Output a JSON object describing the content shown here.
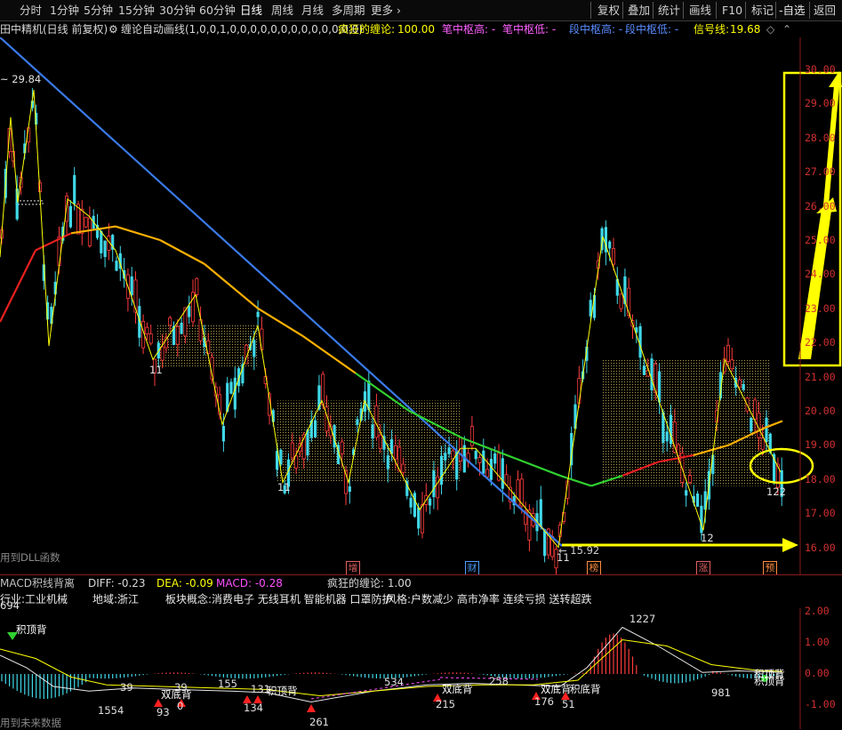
{
  "toolbar": {
    "periods": [
      "分时",
      "1分钟",
      "5分钟",
      "15分钟",
      "30分钟",
      "60分钟",
      "日线",
      "周线",
      "月线",
      "多周期",
      "更多"
    ],
    "active_period": "日线",
    "right_buttons": [
      "复权",
      "叠加",
      "统计",
      "画线",
      "F10",
      "标记",
      "自选",
      "返回"
    ]
  },
  "main_info": {
    "stock_name": "田中精机(日线 前复权)",
    "indicator_formula": "缠论自动画线(1,0,0,1,0,0,0,0,0,0,0,0,0,0,0,0,0)",
    "crazy_label": "疯狂的缠论:",
    "crazy_value": "100.00",
    "pen_high": "笔中枢高: -",
    "pen_low": "笔中枢低: -",
    "seg_high": "段中枢高: -",
    "seg_low": "段中枢低: -",
    "signal_label": "信号线:",
    "signal_value": "19.68"
  },
  "price_axis": [
    "30.00",
    "29.00",
    "28.00",
    "27.00",
    "26.00",
    "25.00",
    "24.00",
    "23.00",
    "22.00",
    "21.00",
    "20.00",
    "19.00",
    "18.00",
    "17.00",
    "16.00"
  ],
  "chart_labels": {
    "high_price": "29.84",
    "low_price": "15.92",
    "dll_note": "用到DLL函数",
    "pivot_11a": "11",
    "pivot_11b": "11",
    "pivot_11c": "11",
    "pivot_12": "12",
    "pivot_122": "122"
  },
  "event_markers": [
    {
      "text": "增",
      "color": "#e06060"
    },
    {
      "text": "财",
      "color": "#4aa0ff"
    },
    {
      "text": "榜",
      "color": "#ff8c3c"
    },
    {
      "text": "涨",
      "color": "#e06060"
    },
    {
      "text": "预",
      "color": "#ff8c3c"
    }
  ],
  "macd_info": {
    "title": "MACD积线背离",
    "diff": "DIFF: -0.23",
    "dea": "DEA: -0.09",
    "macd": "MACD: -0.28",
    "crazy": "疯狂的缠论: 1.00"
  },
  "industry_info": {
    "industry": "行业:工业机械",
    "region": "地域:浙江",
    "concept": "板块概念:消费电子 无线耳机 智能机器 口罩防护",
    "style": "风格:户数减少 高市净率 连续亏损 送转超跌"
  },
  "macd_axis": [
    "2.00",
    "1.00",
    "0.00",
    "-1.00"
  ],
  "macd_labels": {
    "l694": "694",
    "top_div": "积顶背",
    "l39a": "39",
    "l1554": "1554",
    "l93": "93",
    "l0": "0",
    "l39b": "39",
    "dbl1": "双底背",
    "l155": "155",
    "l134": "134",
    "l131": "131",
    "top_div2": "积顶背",
    "l261": "261",
    "l534": "534",
    "dbl2": "双底背",
    "l215": "215",
    "l258": "258",
    "dbl3": "双底背",
    "dbl4": "积底背",
    "l176": "176",
    "l51": "51",
    "l1227": "1227",
    "l981": "981",
    "bottom_div": "积顶背",
    "top_div3": "积顶背",
    "future_note": "用到未来数据"
  },
  "colors": {
    "up": "#ff3b3b",
    "down": "#40d8e8",
    "yellow": "#ffff00",
    "blue_line": "#3a7ae8",
    "ma_orange": "#ffb000",
    "ma_green": "#30d030",
    "ma_red": "#e82020"
  }
}
